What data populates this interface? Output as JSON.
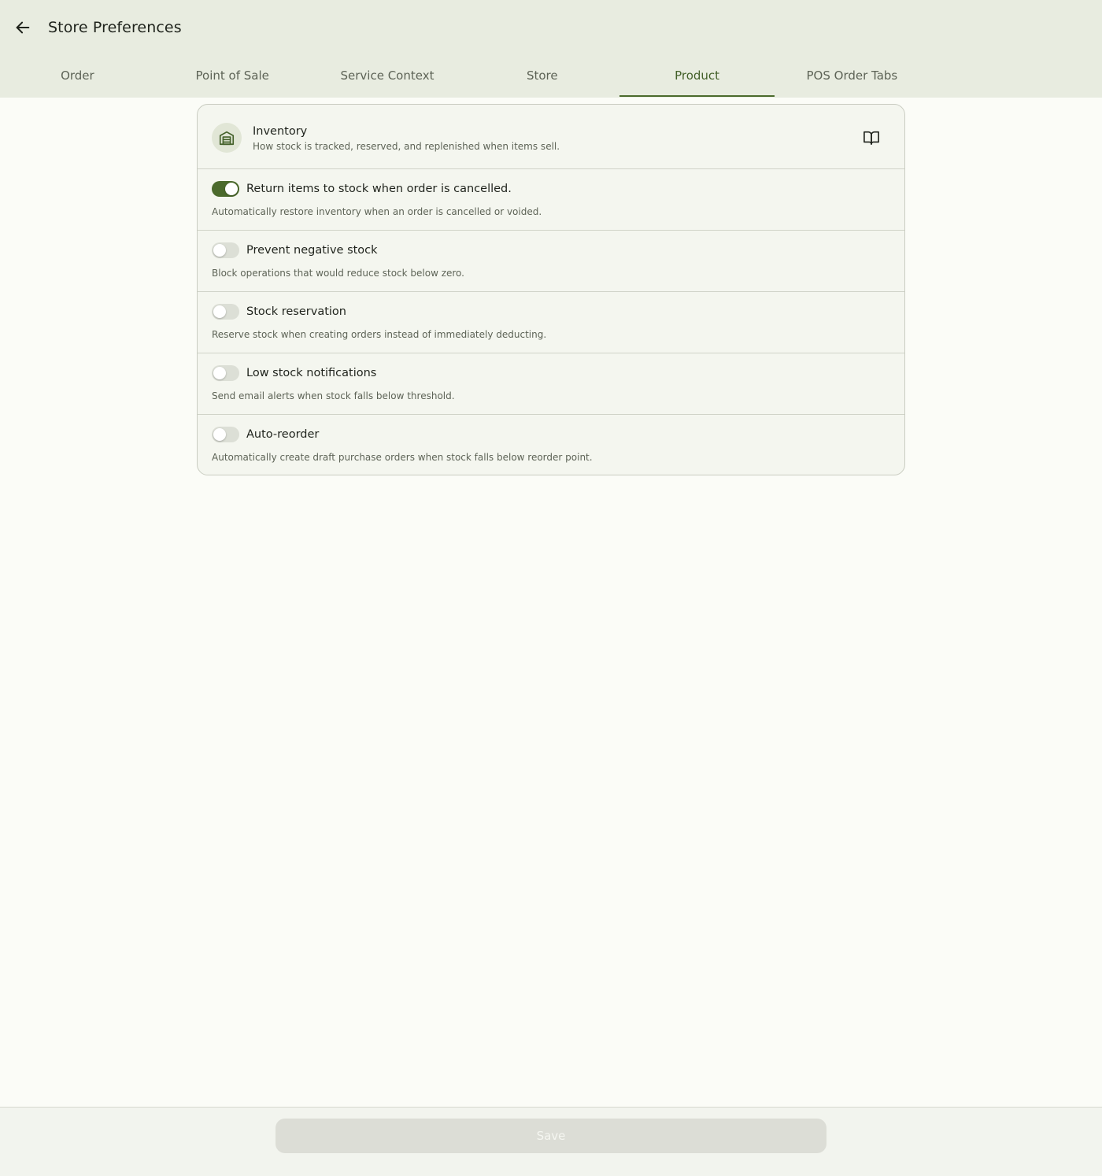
{
  "header": {
    "title": "Store Preferences",
    "back_icon": "arrow-left-icon"
  },
  "tabs": [
    {
      "label": "Order",
      "active": false
    },
    {
      "label": "Point of Sale",
      "active": false
    },
    {
      "label": "Service Context",
      "active": false
    },
    {
      "label": "Store",
      "active": false
    },
    {
      "label": "Product",
      "active": true
    },
    {
      "label": "POS Order Tabs",
      "active": false
    }
  ],
  "section": {
    "icon": "warehouse-icon",
    "title": "Inventory",
    "subtitle": "How stock is tracked, reserved, and replenished when items sell.",
    "docs_icon": "book-open-icon"
  },
  "settings": [
    {
      "title": "Return items to stock when order is cancelled.",
      "description": "Automatically restore inventory when an order is cancelled or voided.",
      "enabled": true
    },
    {
      "title": "Prevent negative stock",
      "description": "Block operations that would reduce stock below zero.",
      "enabled": false
    },
    {
      "title": "Stock reservation",
      "description": "Reserve stock when creating orders instead of immediately deducting.",
      "enabled": false
    },
    {
      "title": "Low stock notifications",
      "description": "Send email alerts when stock falls below threshold.",
      "enabled": false
    },
    {
      "title": "Auto-reorder",
      "description": "Automatically create draft purchase orders when stock falls below reorder point.",
      "enabled": false
    }
  ],
  "footer": {
    "save_label": "Save",
    "save_disabled": true
  },
  "colors": {
    "accent": "#4b6a2c",
    "header_bg": "#e8ece0",
    "page_bg": "#fbfcf7",
    "card_bg": "#f4f6ef",
    "toggle_off": "#dcdfd6",
    "save_disabled_bg": "#dcddd6"
  }
}
